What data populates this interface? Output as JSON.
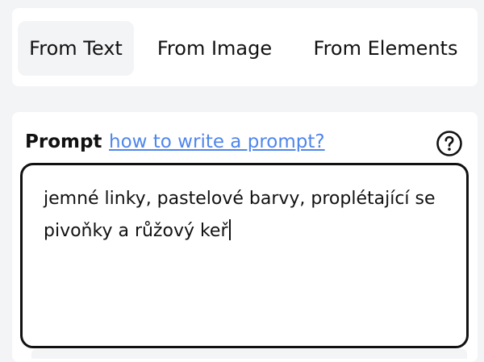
{
  "tabs": [
    {
      "label": "From Text",
      "active": true
    },
    {
      "label": "From Image",
      "active": false
    },
    {
      "label": "From Elements",
      "active": false
    }
  ],
  "prompt": {
    "label": "Prompt",
    "help_link": "how to write a prompt?",
    "help_icon": "question-circle-icon",
    "value": "jemné linky, pastelové barvy, proplétající se pivoňky a růžový keř"
  },
  "colors": {
    "background": "#f3f4f6",
    "card": "#ffffff",
    "link": "#4f86ec",
    "text": "#111111"
  }
}
